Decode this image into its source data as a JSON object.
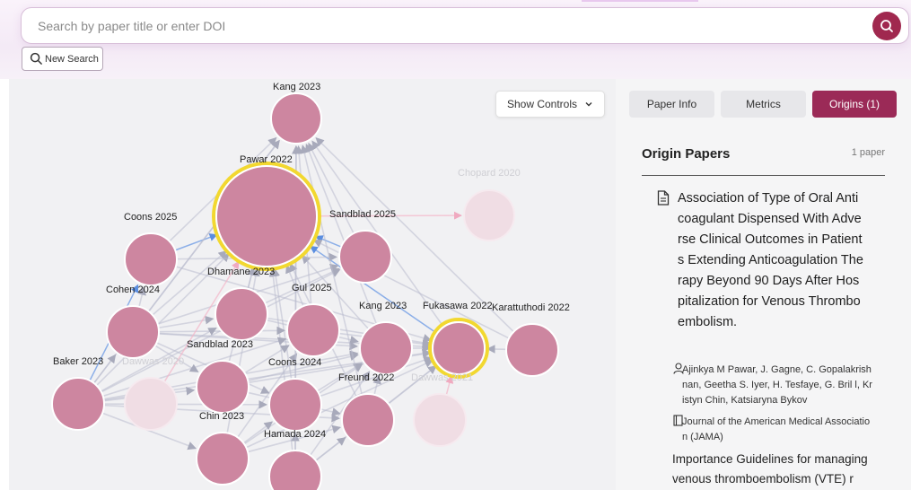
{
  "search": {
    "placeholder": "Search by paper title or enter DOI",
    "new_search_label": "New Search"
  },
  "graph": {
    "show_controls_label": "Show Controls",
    "nodes": [
      {
        "id": "kang2023",
        "label": "Kang 2023"
      },
      {
        "id": "pawar2022",
        "label": "Pawar 2022"
      },
      {
        "id": "chopard2020",
        "label": "Chopard 2020"
      },
      {
        "id": "coons2025",
        "label": "Coons 2025"
      },
      {
        "id": "sandblad2025",
        "label": "Sandblad 2025"
      },
      {
        "id": "dhamane2023",
        "label": "Dhamane 2023"
      },
      {
        "id": "gul2025",
        "label": "Gul 2025"
      },
      {
        "id": "cohen2024",
        "label": "Cohen 2024"
      },
      {
        "id": "kang2023b",
        "label": "Kang 2023"
      },
      {
        "id": "fukasawa2022",
        "label": "Fukasawa 2022"
      },
      {
        "id": "karattuthodi2022",
        "label": "Karattuthodi 2022"
      },
      {
        "id": "baker2023",
        "label": "Baker 2023"
      },
      {
        "id": "dawwas2020",
        "label": "Dawwas 2020"
      },
      {
        "id": "sandblad2023",
        "label": "Sandblad 2023"
      },
      {
        "id": "coons2024",
        "label": "Coons 2024"
      },
      {
        "id": "freund2022",
        "label": "Freund 2022"
      },
      {
        "id": "dawwas2021",
        "label": "Dawwas 2021"
      },
      {
        "id": "chin2023",
        "label": "Chin 2023"
      },
      {
        "id": "hamada2024",
        "label": "Hamada 2024"
      }
    ]
  },
  "tabs": {
    "paper_info": "Paper Info",
    "metrics": "Metrics",
    "origins": "Origins (1)"
  },
  "panel": {
    "title": "Origin Papers",
    "count": "1 paper",
    "paper": {
      "title": "Association of Type of Oral Anticoagulant Dispensed With Adverse Clinical Outcomes in Patients Extending Anticoagulation Therapy Beyond 90 Days After Hospitalization for Venous Thromboembolism.",
      "authors": "Ajinkya M Pawar, J. Gagne, C. Gopalakrishnan, Geetha S. Iyer, H. Tesfaye, G. Bril l, Kristyn Chin, Katsiaryna Bykov",
      "journal": "Journal of the American Medical Association (JAMA)"
    },
    "next_paper_title": "Importance Guidelines for managing venous thromboembolism (VTE) r"
  },
  "colors": {
    "brand": "#9b2a57",
    "node_fill": "#cd86a0",
    "node_faded": "#f0dde4",
    "highlight_ring": "#f2d830"
  },
  "icons": {
    "search": "search-icon",
    "chevron": "chevron-down-icon",
    "document": "document-icon",
    "authors": "user-icon",
    "journal": "book-icon"
  }
}
